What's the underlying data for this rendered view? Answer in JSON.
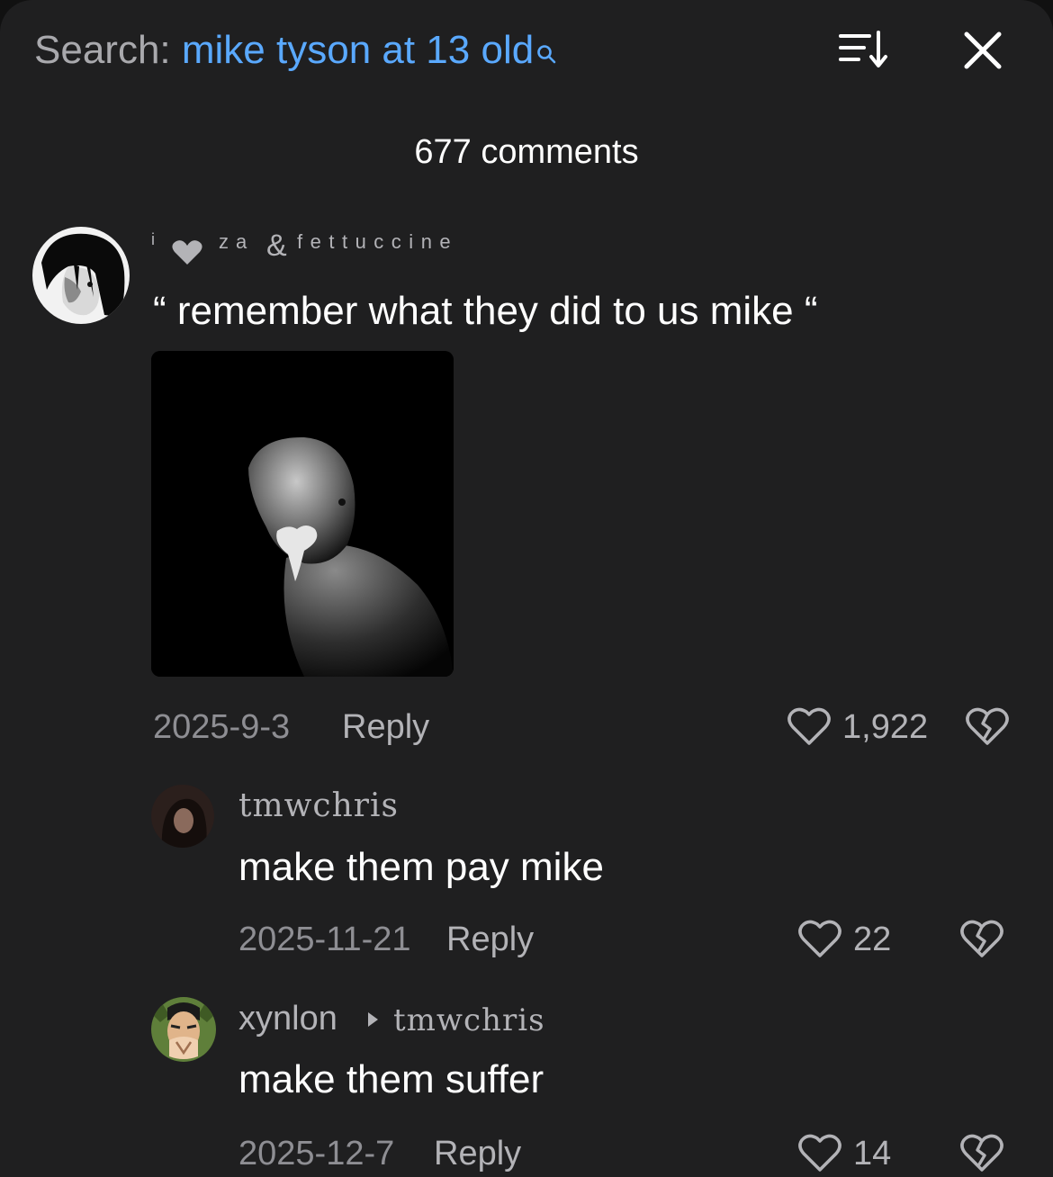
{
  "header": {
    "search_prefix": "Search:",
    "search_query": "mike tyson at 13 old",
    "search_icon": "magnifier-icon",
    "sort_icon": "sort-lines-arrow-icon",
    "close_icon": "close-icon"
  },
  "comment_count": "677 comments",
  "comments": [
    {
      "username": {
        "part1": "i",
        "part2": "za",
        "part3": "&",
        "part4": "fettuccine"
      },
      "text": "“ remember what they did to us mike “",
      "has_image": true,
      "date": "2025-9-3",
      "reply_label": "Reply",
      "likes": "1,922"
    },
    {
      "username": "tmwchris",
      "text": "make them pay mike",
      "date": "2025-11-21",
      "reply_label": "Reply",
      "likes": "22"
    },
    {
      "username": "xynlon",
      "reply_to": "tmwchris",
      "text": "make them suffer",
      "date": "2025-12-7",
      "reply_label": "Reply",
      "likes": "14"
    }
  ],
  "colors": {
    "background": "#1f1f20",
    "accent": "#5aa9ff",
    "muted": "#8e8e93",
    "secondary": "#b3b3b7",
    "text": "#ffffff"
  }
}
